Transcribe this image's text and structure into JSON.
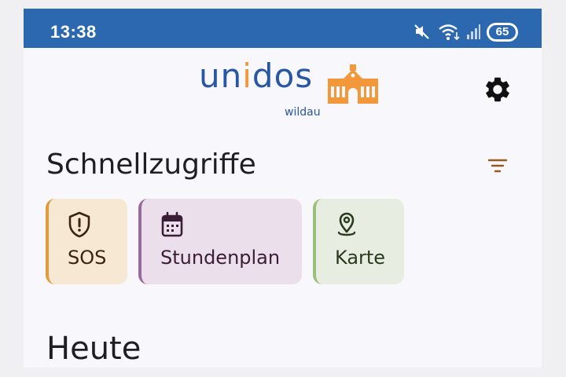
{
  "status_bar": {
    "time": "13:38",
    "battery": "65",
    "icons": [
      "mute-icon",
      "wifi-icon",
      "signal-icon",
      "battery-icon"
    ],
    "background": "#2c68b0"
  },
  "header": {
    "logo_parts": [
      "un",
      "i",
      "dos"
    ],
    "logo_sub": "wildau",
    "logo_colors": {
      "primary": "#2857a3",
      "accent": "#f2973a"
    },
    "settings_icon": "gear-icon"
  },
  "quick_access": {
    "title": "Schnellzugriffe",
    "filter_icon": "filter-icon",
    "tiles": [
      {
        "label": "SOS",
        "icon": "shield-alert-icon",
        "accent": "#e39a3c"
      },
      {
        "label": "Stundenplan",
        "icon": "calendar-icon",
        "accent": "#9a6a9c"
      },
      {
        "label": "Karte",
        "icon": "map-pin-icon",
        "accent": "#98c07a"
      }
    ]
  },
  "today": {
    "title": "Heute"
  }
}
